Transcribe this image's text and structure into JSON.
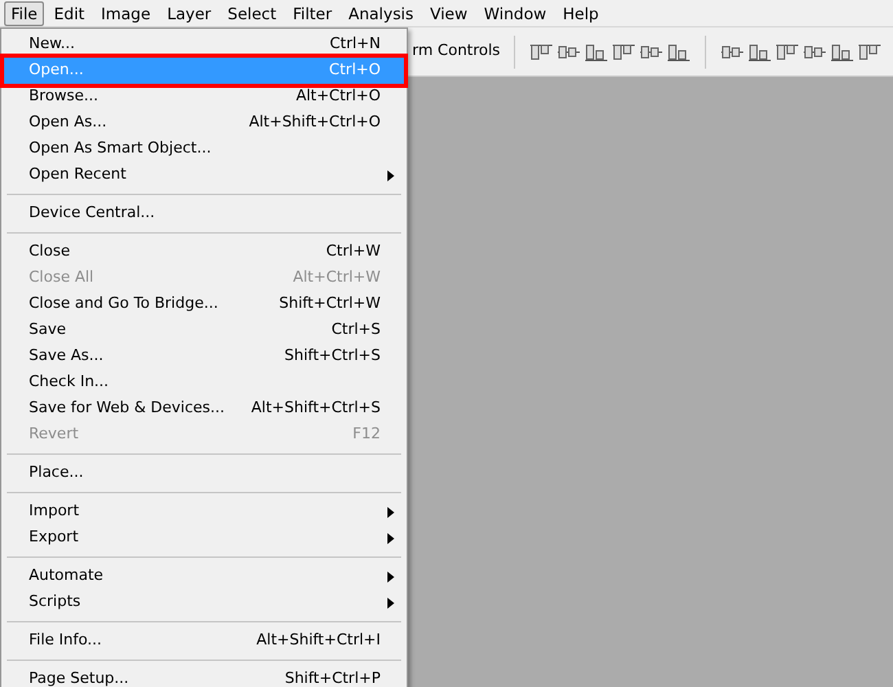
{
  "menu_bar": [
    {
      "label": "File",
      "selected": true
    },
    {
      "label": "Edit",
      "selected": false
    },
    {
      "label": "Image",
      "selected": false
    },
    {
      "label": "Layer",
      "selected": false
    },
    {
      "label": "Select",
      "selected": false
    },
    {
      "label": "Filter",
      "selected": false
    },
    {
      "label": "Analysis",
      "selected": false
    },
    {
      "label": "View",
      "selected": false
    },
    {
      "label": "Window",
      "selected": false
    },
    {
      "label": "Help",
      "selected": false
    }
  ],
  "options_bar": {
    "label": "rm Controls"
  },
  "file_menu": [
    [
      {
        "label": "New...",
        "shortcut": "Ctrl+N",
        "selected": false,
        "disabled": false,
        "submenu": false,
        "outlined": false
      },
      {
        "label": "Open...",
        "shortcut": "Ctrl+O",
        "selected": true,
        "disabled": false,
        "submenu": false,
        "outlined": true
      },
      {
        "label": "Browse...",
        "shortcut": "Alt+Ctrl+O",
        "selected": false,
        "disabled": false,
        "submenu": false,
        "outlined": false
      },
      {
        "label": "Open As...",
        "shortcut": "Alt+Shift+Ctrl+O",
        "selected": false,
        "disabled": false,
        "submenu": false,
        "outlined": false
      },
      {
        "label": "Open As Smart Object...",
        "selected": false,
        "disabled": false,
        "submenu": false,
        "outlined": false
      },
      {
        "label": "Open Recent",
        "selected": false,
        "disabled": false,
        "submenu": true,
        "outlined": false
      }
    ],
    [
      {
        "label": "Device Central...",
        "selected": false,
        "disabled": false,
        "submenu": false,
        "outlined": false
      }
    ],
    [
      {
        "label": "Close",
        "shortcut": "Ctrl+W",
        "selected": false,
        "disabled": false,
        "submenu": false,
        "outlined": false
      },
      {
        "label": "Close All",
        "shortcut": "Alt+Ctrl+W",
        "selected": false,
        "disabled": true,
        "submenu": false,
        "outlined": false
      },
      {
        "label": "Close and Go To Bridge...",
        "shortcut": "Shift+Ctrl+W",
        "selected": false,
        "disabled": false,
        "submenu": false,
        "outlined": false
      },
      {
        "label": "Save",
        "shortcut": "Ctrl+S",
        "selected": false,
        "disabled": false,
        "submenu": false,
        "outlined": false
      },
      {
        "label": "Save As...",
        "shortcut": "Shift+Ctrl+S",
        "selected": false,
        "disabled": false,
        "submenu": false,
        "outlined": false
      },
      {
        "label": "Check In...",
        "selected": false,
        "disabled": false,
        "submenu": false,
        "outlined": false
      },
      {
        "label": "Save for Web & Devices...",
        "shortcut": "Alt+Shift+Ctrl+S",
        "selected": false,
        "disabled": false,
        "submenu": false,
        "outlined": false
      },
      {
        "label": "Revert",
        "shortcut": "F12",
        "selected": false,
        "disabled": true,
        "submenu": false,
        "outlined": false
      }
    ],
    [
      {
        "label": "Place...",
        "selected": false,
        "disabled": false,
        "submenu": false,
        "outlined": false
      }
    ],
    [
      {
        "label": "Import",
        "selected": false,
        "disabled": false,
        "submenu": true,
        "outlined": false
      },
      {
        "label": "Export",
        "selected": false,
        "disabled": false,
        "submenu": true,
        "outlined": false
      }
    ],
    [
      {
        "label": "Automate",
        "selected": false,
        "disabled": false,
        "submenu": true,
        "outlined": false
      },
      {
        "label": "Scripts",
        "selected": false,
        "disabled": false,
        "submenu": true,
        "outlined": false
      }
    ],
    [
      {
        "label": "File Info...",
        "shortcut": "Alt+Shift+Ctrl+I",
        "selected": false,
        "disabled": false,
        "submenu": false,
        "outlined": false
      }
    ],
    [
      {
        "label": "Page Setup...",
        "shortcut": "Shift+Ctrl+P",
        "selected": false,
        "disabled": false,
        "submenu": false,
        "outlined": false
      }
    ]
  ]
}
